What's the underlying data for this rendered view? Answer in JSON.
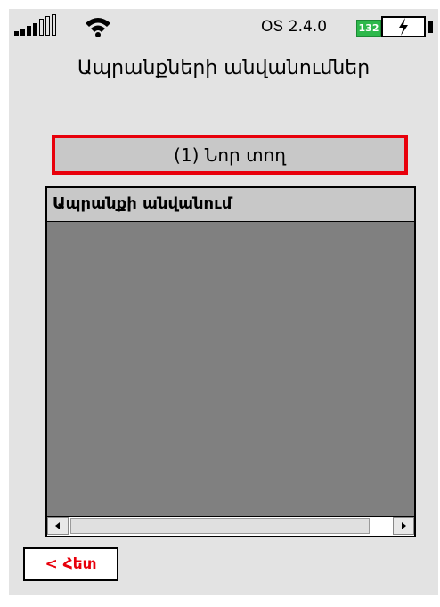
{
  "status_bar": {
    "version": "ՕՏ 2.4.0",
    "battery_level": "132",
    "colors": {
      "battery_badge": "#2db84b"
    }
  },
  "title": "Ապրանքների անվանումներ",
  "new_row_button": {
    "label": "(1) Նոր տող",
    "border_color": "#e8000b"
  },
  "grid": {
    "columns": [
      "Ապրանքի անվանում"
    ],
    "rows": []
  },
  "back_button": {
    "label": "< Հետ",
    "color": "#e8000b"
  }
}
